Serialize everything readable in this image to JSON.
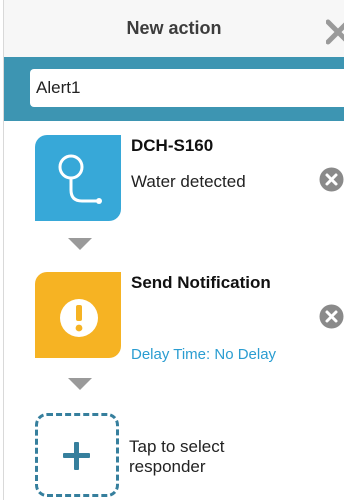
{
  "header": {
    "title": "New action",
    "close_icon": "close-icon"
  },
  "action_name": {
    "value": "Alert1"
  },
  "colors": {
    "accent_bar": "#3d95b2",
    "sensor_tile": "#37a8d8",
    "notification_tile": "#f6b323",
    "link_blue": "#2a9dd1",
    "add_tile_border": "#367f9d"
  },
  "steps": [
    {
      "device": "DCH-S160",
      "event": "Water detected",
      "icon": "water-sensor-icon",
      "remove_icon": "remove-icon"
    },
    {
      "device": "Send Notification",
      "delay": "Delay Time: No Delay",
      "icon": "exclamation-icon",
      "remove_icon": "remove-icon"
    }
  ],
  "add_responder": {
    "label": "Tap to select responder",
    "icon": "plus-icon"
  }
}
